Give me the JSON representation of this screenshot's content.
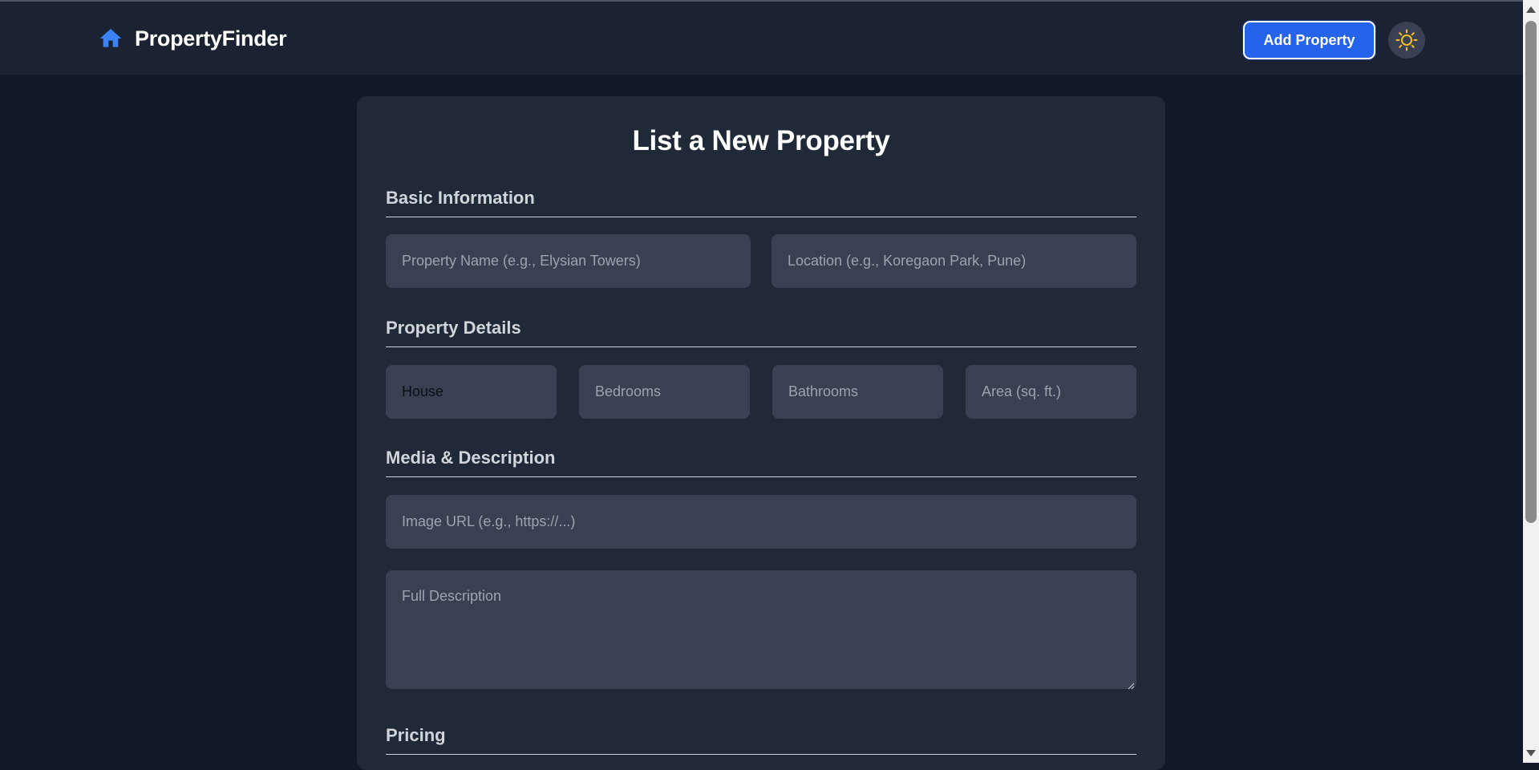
{
  "brand": {
    "name": "PropertyFinder",
    "icon": "home-icon",
    "accent_color": "#3b82f6"
  },
  "header": {
    "add_property_label": "Add Property",
    "theme_toggle_icon": "sun-icon",
    "theme_icon_color": "#fbbf24"
  },
  "form": {
    "title": "List a New Property",
    "sections": {
      "basic": {
        "heading": "Basic Information",
        "property_name_placeholder": "Property Name (e.g., Elysian Towers)",
        "location_placeholder": "Location (e.g., Koregaon Park, Pune)"
      },
      "details": {
        "heading": "Property Details",
        "type_selected": "House",
        "bedrooms_placeholder": "Bedrooms",
        "bathrooms_placeholder": "Bathrooms",
        "area_placeholder": "Area (sq. ft.)"
      },
      "media": {
        "heading": "Media & Description",
        "image_url_placeholder": "Image URL (e.g., https://...)",
        "description_placeholder": "Full Description"
      },
      "pricing": {
        "heading": "Pricing"
      }
    }
  },
  "colors": {
    "background": "#111827",
    "navbar": "#1b2332",
    "card": "#1f2937",
    "field": "#374151",
    "primary_button": "#2563eb"
  }
}
